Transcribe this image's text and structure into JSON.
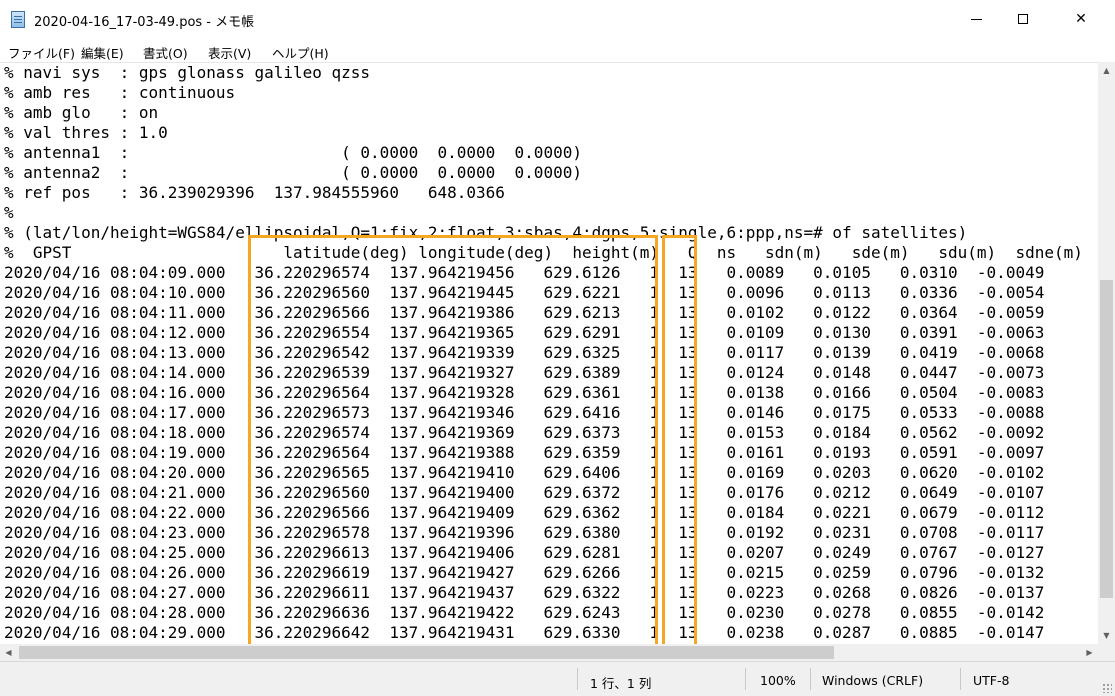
{
  "window": {
    "title": "2020-04-16_17-03-49.pos - メモ帳",
    "close_glyph": "✕"
  },
  "menu": [
    "ファイル(F)",
    "編集(E)",
    "書式(O)",
    "表示(V)",
    "ヘルプ(H)"
  ],
  "lines": [
    "% navi sys  : gps glonass galileo qzss",
    "% amb res   : continuous",
    "% amb glo   : on",
    "% val thres : 1.0",
    "% antenna1  :                      ( 0.0000  0.0000  0.0000)",
    "% antenna2  :                      ( 0.0000  0.0000  0.0000)",
    "% ref pos   : 36.239029396  137.984555960   648.0366",
    "%",
    "% (lat/lon/height=WGS84/ellipsoidal,Q=1:fix,2:float,3:sbas,4:dgps,5:single,6:ppp,ns=# of satellites)",
    "%  GPST                      latitude(deg) longitude(deg)  height(m)   Q  ns   sdn(m)   sde(m)   sdu(m)  sdne(m)",
    "2020/04/16 08:04:09.000   36.220296574  137.964219456   629.6126   1  13   0.0089   0.0105   0.0310  -0.0049",
    "2020/04/16 08:04:10.000   36.220296560  137.964219445   629.6221   1  13   0.0096   0.0113   0.0336  -0.0054",
    "2020/04/16 08:04:11.000   36.220296566  137.964219386   629.6213   1  13   0.0102   0.0122   0.0364  -0.0059",
    "2020/04/16 08:04:12.000   36.220296554  137.964219365   629.6291   1  13   0.0109   0.0130   0.0391  -0.0063",
    "2020/04/16 08:04:13.000   36.220296542  137.964219339   629.6325   1  13   0.0117   0.0139   0.0419  -0.0068",
    "2020/04/16 08:04:14.000   36.220296539  137.964219327   629.6389   1  13   0.0124   0.0148   0.0447  -0.0073",
    "2020/04/16 08:04:16.000   36.220296564  137.964219328   629.6361   1  13   0.0138   0.0166   0.0504  -0.0083",
    "2020/04/16 08:04:17.000   36.220296573  137.964219346   629.6416   1  13   0.0146   0.0175   0.0533  -0.0088",
    "2020/04/16 08:04:18.000   36.220296574  137.964219369   629.6373   1  13   0.0153   0.0184   0.0562  -0.0092",
    "2020/04/16 08:04:19.000   36.220296564  137.964219388   629.6359   1  13   0.0161   0.0193   0.0591  -0.0097",
    "2020/04/16 08:04:20.000   36.220296565  137.964219410   629.6406   1  13   0.0169   0.0203   0.0620  -0.0102",
    "2020/04/16 08:04:21.000   36.220296560  137.964219400   629.6372   1  13   0.0176   0.0212   0.0649  -0.0107",
    "2020/04/16 08:04:22.000   36.220296566  137.964219409   629.6362   1  13   0.0184   0.0221   0.0679  -0.0112",
    "2020/04/16 08:04:23.000   36.220296578  137.964219396   629.6380   1  13   0.0192   0.0231   0.0708  -0.0117",
    "2020/04/16 08:04:25.000   36.220296613  137.964219406   629.6281   1  13   0.0207   0.0249   0.0767  -0.0127",
    "2020/04/16 08:04:26.000   36.220296619  137.964219427   629.6266   1  13   0.0215   0.0259   0.0796  -0.0132",
    "2020/04/16 08:04:27.000   36.220296611  137.964219437   629.6322   1  13   0.0223   0.0268   0.0826  -0.0137",
    "2020/04/16 08:04:28.000   36.220296636  137.964219422   629.6243   1  13   0.0230   0.0278   0.0855  -0.0142",
    "2020/04/16 08:04:29.000   36.220296642  137.964219431   629.6330   1  13   0.0238   0.0287   0.0885  -0.0147"
  ],
  "status": {
    "position": "1 行、1 列",
    "zoom": "100%",
    "line_ending": "Windows (CRLF)",
    "encoding": "UTF-8"
  },
  "colors": {
    "highlight": "#f5a623"
  }
}
